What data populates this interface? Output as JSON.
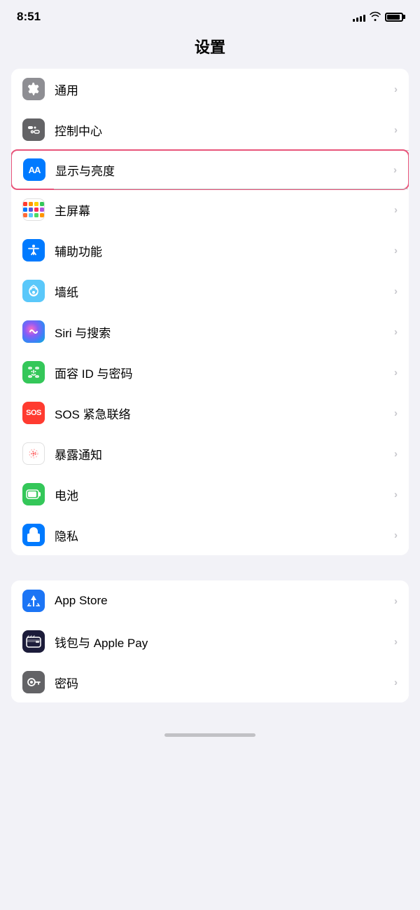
{
  "statusBar": {
    "time": "8:51",
    "signalBars": [
      4,
      6,
      8,
      11,
      13
    ],
    "battery": 90
  },
  "pageTitle": "设置",
  "sections": [
    {
      "id": "system",
      "items": [
        {
          "id": "general",
          "label": "通用",
          "icon": "gear",
          "bg": "gray"
        },
        {
          "id": "control-center",
          "label": "控制中心",
          "icon": "toggle",
          "bg": "gray2"
        },
        {
          "id": "display",
          "label": "显示与亮度",
          "icon": "aa",
          "bg": "blue",
          "highlighted": true
        },
        {
          "id": "home-screen",
          "label": "主屏幕",
          "icon": "dots",
          "bg": "multicolor"
        },
        {
          "id": "accessibility",
          "label": "辅助功能",
          "icon": "accessibility",
          "bg": "blue2"
        },
        {
          "id": "wallpaper",
          "label": "墙纸",
          "icon": "flower",
          "bg": "teal"
        },
        {
          "id": "siri",
          "label": "Siri 与搜索",
          "icon": "siri",
          "bg": "siri"
        },
        {
          "id": "face-id",
          "label": "面容 ID 与密码",
          "icon": "faceid",
          "bg": "green"
        },
        {
          "id": "sos",
          "label": "SOS 紧急联络",
          "icon": "sos",
          "bg": "red"
        },
        {
          "id": "exposure",
          "label": "暴露通知",
          "icon": "exposure",
          "bg": "exposure"
        },
        {
          "id": "battery",
          "label": "电池",
          "icon": "battery",
          "bg": "green2"
        },
        {
          "id": "privacy",
          "label": "隐私",
          "icon": "hand",
          "bg": "blue3"
        }
      ]
    },
    {
      "id": "apps",
      "items": [
        {
          "id": "app-store",
          "label": "App Store",
          "icon": "appstore",
          "bg": "appstore"
        },
        {
          "id": "wallet",
          "label": "钱包与 Apple Pay",
          "icon": "wallet",
          "bg": "wallet"
        },
        {
          "id": "passwords",
          "label": "密码",
          "icon": "key",
          "bg": "password"
        }
      ]
    }
  ]
}
